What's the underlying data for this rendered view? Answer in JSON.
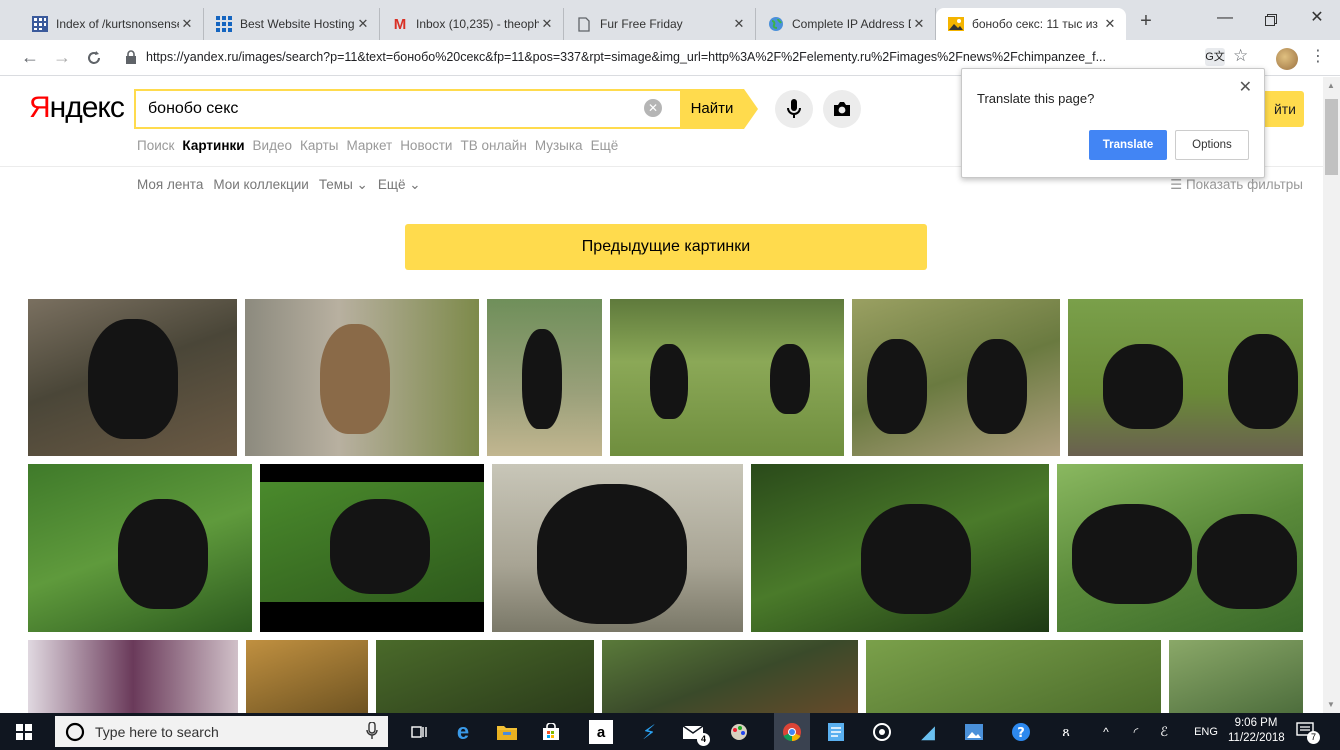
{
  "browser": {
    "tabs": [
      {
        "title": "Index of /kurtsnonsense",
        "icon": "grid-favicon",
        "color": "#3a5a9c"
      },
      {
        "title": "Best Website Hosting S",
        "icon": "grid-favicon",
        "color": "#1565c0"
      },
      {
        "title": "Inbox (10,235) - theoph",
        "icon": "gmail-favicon",
        "color": "#d93025"
      },
      {
        "title": "Fur Free Friday",
        "icon": "page-favicon",
        "color": "#5f6368"
      },
      {
        "title": "Complete IP Address D",
        "icon": "globe-favicon",
        "color": "#34a853"
      },
      {
        "title": "бонобо секс: 11 тыс из",
        "icon": "image-favicon",
        "color": "#f4b400",
        "active": true
      }
    ],
    "url": "https://yandex.ru/images/search?p=11&text=бонобо%20секс&fp=11&pos=337&rpt=simage&img_url=http%3A%2F%2Felementy.ru%2Fimages%2Fnews%2Fchimpanzee_f..."
  },
  "yandex": {
    "logo": "Яндекс",
    "logo_first": "Я",
    "logo_rest": "ндекс",
    "query": "бонобо секс",
    "search_button": "Найти",
    "services": [
      "Поиск",
      "Картинки",
      "Видео",
      "Карты",
      "Маркет",
      "Новости",
      "ТВ онлайн",
      "Музыка",
      "Ещё"
    ],
    "active_service": "Картинки",
    "subnav": [
      "Моя лента",
      "Мои коллекции",
      "Темы ⌄",
      "Ещё ⌄"
    ],
    "filters": "Показать фильтры",
    "prev_button": "Предыдущие картинки",
    "header_right_button": "йти"
  },
  "translate_popup": {
    "title": "Translate this page?",
    "translate": "Translate",
    "options": "Options"
  },
  "taskbar": {
    "search_placeholder": "Type here to search",
    "mail_badge": "4",
    "lang": "ENG",
    "time": "9:06 PM",
    "date": "11/22/2018",
    "notif_count": "7"
  }
}
